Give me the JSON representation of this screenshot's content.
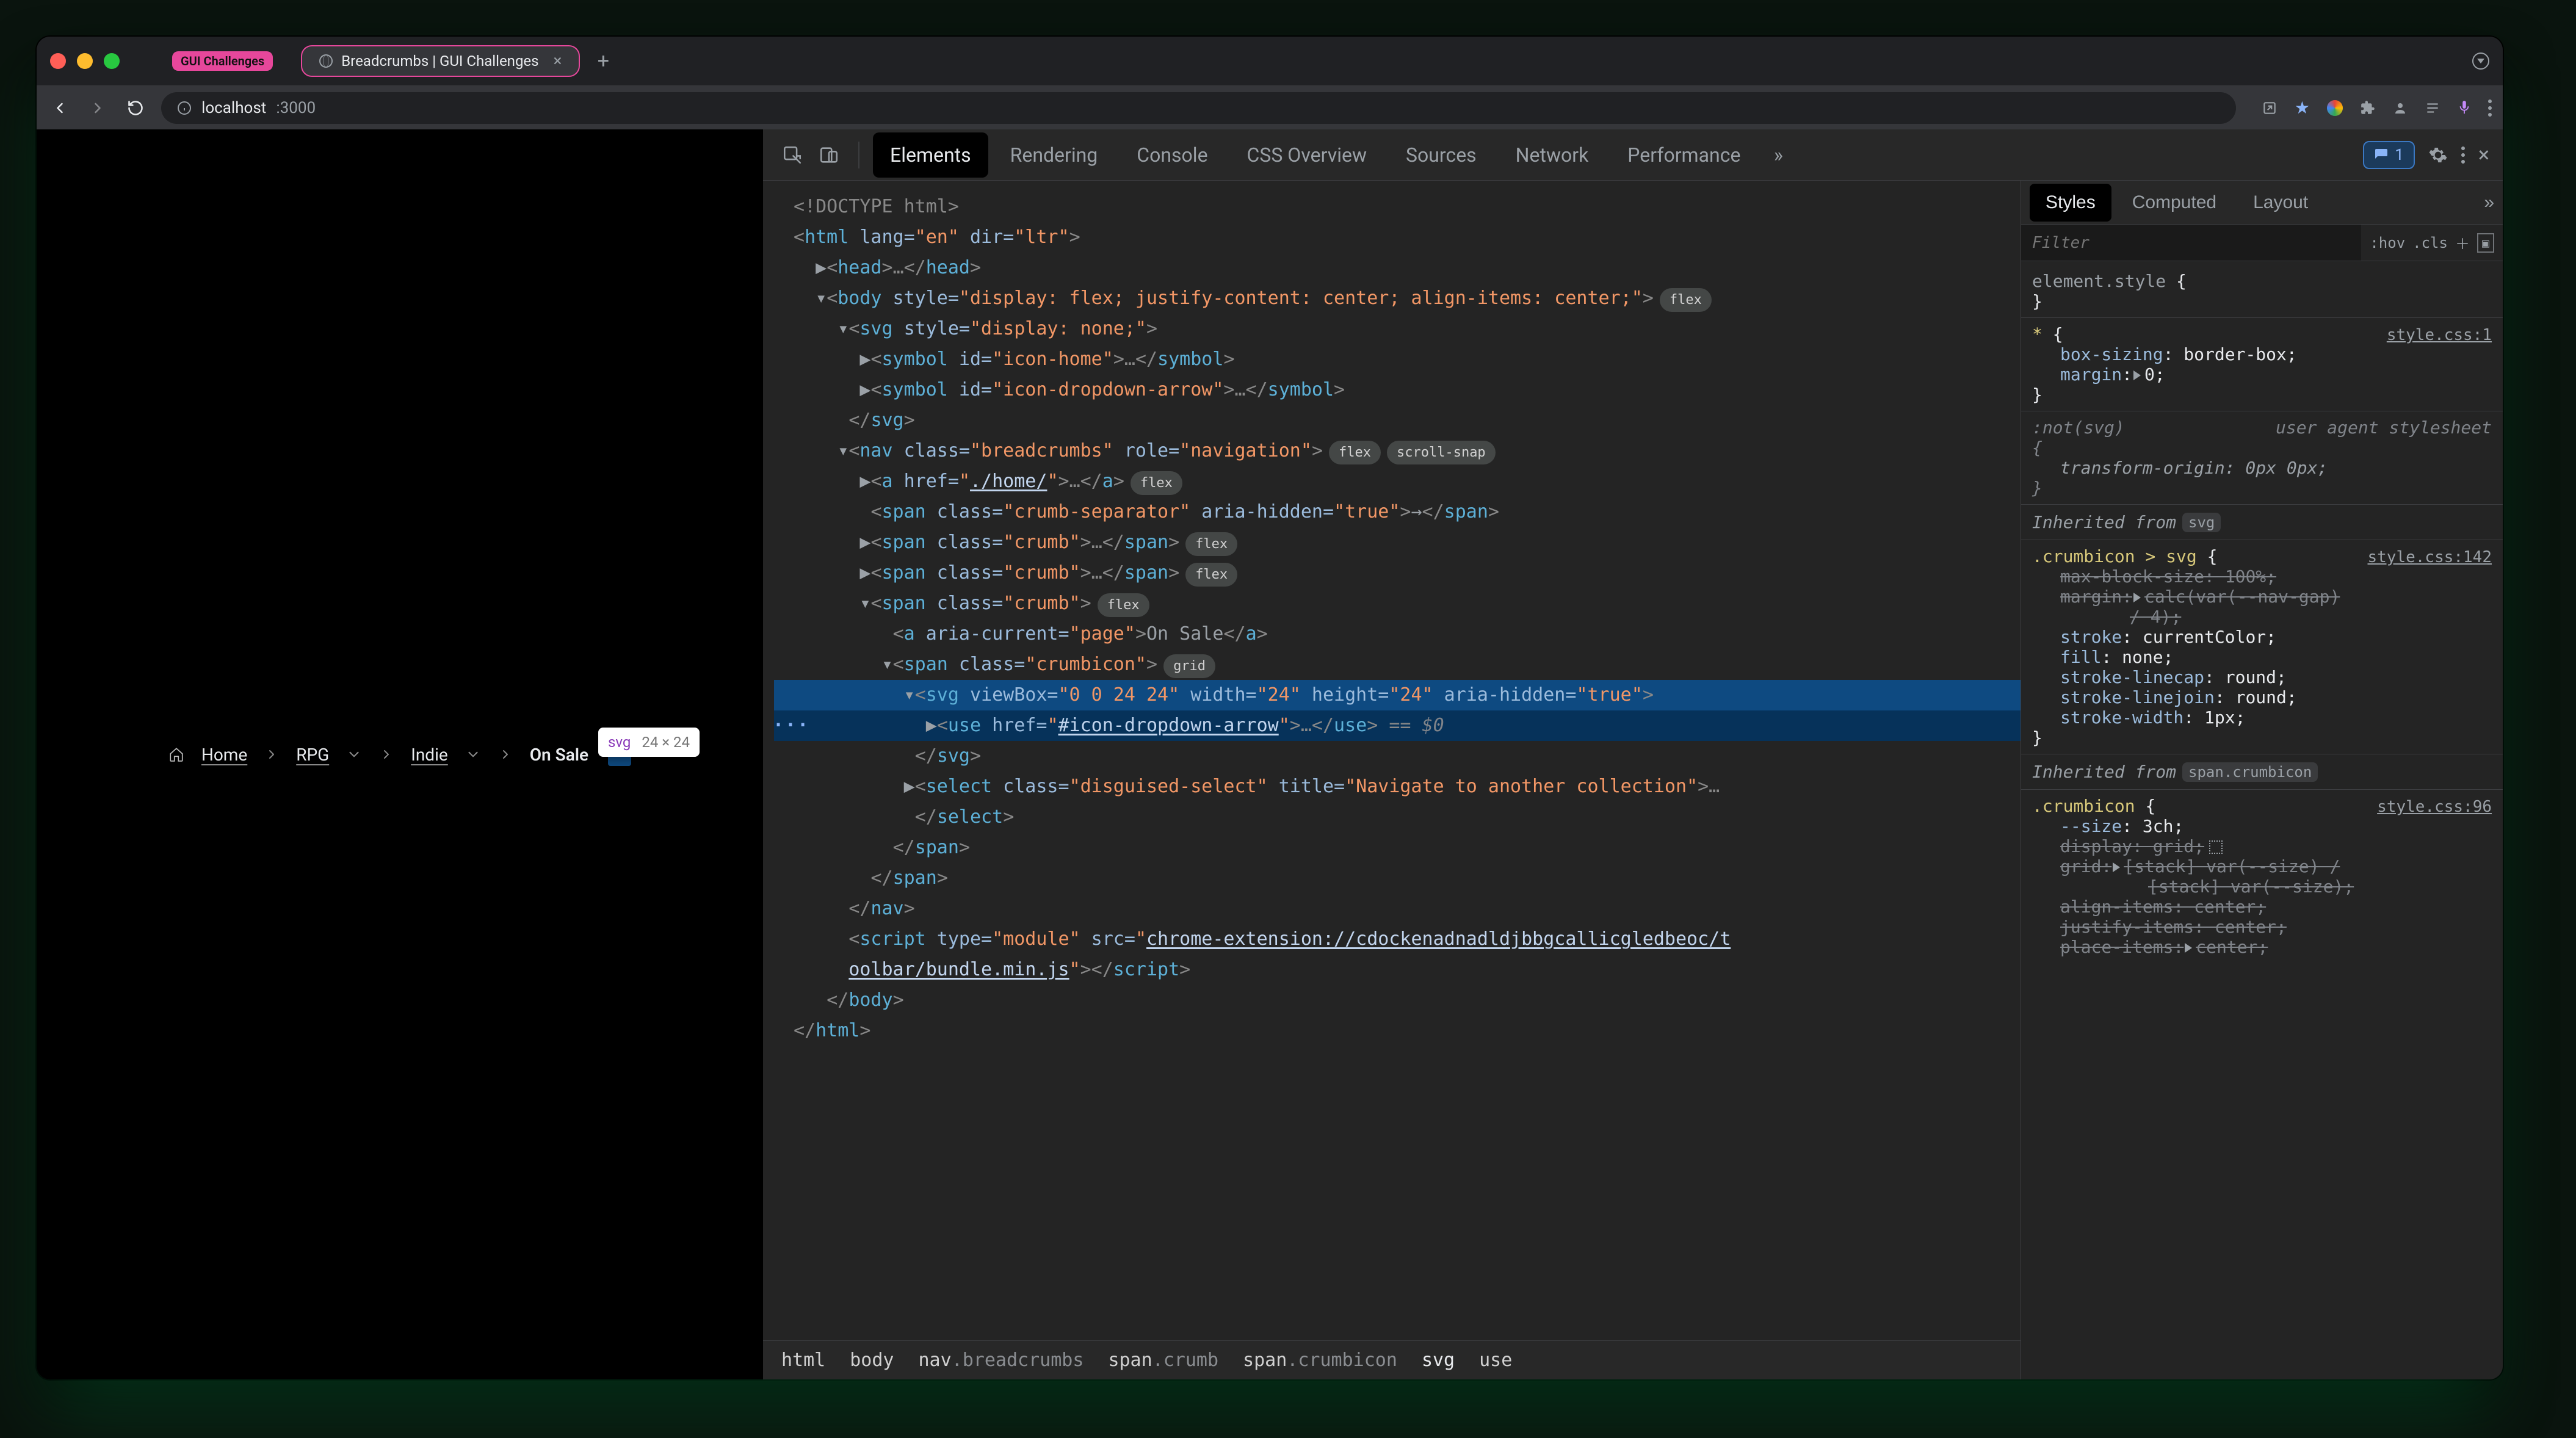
{
  "browser": {
    "tabs": {
      "inactive_chip": "GUI Challenges",
      "active_title": "Breadcrumbs | GUI Challenges"
    },
    "url_host": "localhost",
    "url_path": ":3000"
  },
  "page_breadcrumbs": {
    "home": "Home",
    "rpg": "RPG",
    "indie": "Indie",
    "onsale": "On Sale"
  },
  "tooltip": {
    "tag": "svg",
    "dims": "24 × 24"
  },
  "devtools": {
    "tabs": {
      "elements": "Elements",
      "rendering": "Rendering",
      "console": "Console",
      "cssoverview": "CSS Overview",
      "sources": "Sources",
      "network": "Network",
      "performance": "Performance"
    },
    "issues_count": "1",
    "styles_tabs": {
      "styles": "Styles",
      "computed": "Computed",
      "layout": "Layout"
    },
    "filter_placeholder": "Filter",
    "filter_hov": ":hov",
    "filter_cls": ".cls",
    "dom_crumbs_parts": {
      "html": "html",
      "body": "body",
      "nav": "nav",
      "navcls": ".breadcrumbs",
      "span1": "span",
      "span1cls": ".crumb",
      "span2": "span",
      "span2cls": ".crumbicon",
      "svg": "svg",
      "use": "use"
    }
  },
  "dom": {
    "l1": "<!DOCTYPE html>",
    "l2_open": "<",
    "l2_tag": "html",
    "l2_a1": " lang=",
    "l2_v1": "\"en\"",
    "l2_a2": " dir=",
    "l2_v2": "\"ltr\"",
    "l2_close": ">",
    "l3_tri": "▶",
    "l3_open": "<",
    "l3_tag": "head",
    "l3_close": ">",
    "l3_dots": "…",
    "l3_endopen": "</",
    "l3_endtag": "head",
    "l3_endclose": ">",
    "l4_tri": "▾",
    "l4_open": "<",
    "l4_tag": "body",
    "l4_a1": " style=",
    "l4_v1": "\"display: flex; justify-content: center; align-items: center;\"",
    "l4_close": ">",
    "l4_pill": "flex",
    "l5_tri": "▾",
    "l5_open": "<",
    "l5_tag": "svg",
    "l5_a1": " style=",
    "l5_v1": "\"display: none;\"",
    "l5_close": ">",
    "l6_tri": "▶",
    "l6_open": "<",
    "l6_tag": "symbol",
    "l6_a1": " id=",
    "l6_v1": "\"icon-home\"",
    "l6_close": ">",
    "l6_dots": "…",
    "l6_endopen": "</",
    "l6_endtag": "symbol",
    "l6_endclose": ">",
    "l7_tri": "▶",
    "l7_open": "<",
    "l7_tag": "symbol",
    "l7_a1": " id=",
    "l7_v1": "\"icon-dropdown-arrow\"",
    "l7_close": ">",
    "l7_dots": "…",
    "l7_endopen": "</",
    "l7_endtag": "symbol",
    "l7_endclose": ">",
    "l8_open": "</",
    "l8_tag": "svg",
    "l8_close": ">",
    "l9_tri": "▾",
    "l9_open": "<",
    "l9_tag": "nav",
    "l9_a1": " class=",
    "l9_v1": "\"breadcrumbs\"",
    "l9_a2": " role=",
    "l9_v2": "\"navigation\"",
    "l9_close": ">",
    "l9_pill1": "flex",
    "l9_pill2": "scroll-snap",
    "l10_tri": "▶",
    "l10_open": "<",
    "l10_tag": "a",
    "l10_a1": " href=",
    "l10_v1": "\"",
    "l10_link": "./home/",
    "l10_v1b": "\"",
    "l10_close": ">",
    "l10_dots": "…",
    "l10_endopen": "</",
    "l10_endtag": "a",
    "l10_endclose": ">",
    "l10_pill": "flex",
    "l11_open": "<",
    "l11_tag": "span",
    "l11_a1": " class=",
    "l11_v1": "\"crumb-separator\"",
    "l11_a2": " aria-hidden=",
    "l11_v2": "\"true\"",
    "l11_close": ">",
    "l11_text": "→",
    "l11_endopen": "</",
    "l11_endtag": "span",
    "l11_endclose": ">",
    "l12_tri": "▶",
    "l12_open": "<",
    "l12_tag": "span",
    "l12_a1": " class=",
    "l12_v1": "\"crumb\"",
    "l12_close": ">",
    "l12_dots": "…",
    "l12_endopen": "</",
    "l12_endtag": "span",
    "l12_endclose": ">",
    "l12_pill": "flex",
    "l13_tri": "▶",
    "l13_open": "<",
    "l13_tag": "span",
    "l13_a1": " class=",
    "l13_v1": "\"crumb\"",
    "l13_close": ">",
    "l13_dots": "…",
    "l13_endopen": "</",
    "l13_endtag": "span",
    "l13_endclose": ">",
    "l13_pill": "flex",
    "l14_tri": "▾",
    "l14_open": "<",
    "l14_tag": "span",
    "l14_a1": " class=",
    "l14_v1": "\"crumb\"",
    "l14_close": ">",
    "l14_pill": "flex",
    "l15_open": "<",
    "l15_tag": "a",
    "l15_a1": " aria-current=",
    "l15_v1": "\"page\"",
    "l15_close": ">",
    "l15_text": "On Sale",
    "l15_endopen": "</",
    "l15_endtag": "a",
    "l15_endclose": ">",
    "l16_tri": "▾",
    "l16_open": "<",
    "l16_tag": "span",
    "l16_a1": " class=",
    "l16_v1": "\"crumbicon\"",
    "l16_close": ">",
    "l16_pill": "grid",
    "l17_tri": "▾",
    "l17_open": "<",
    "l17_tag": "svg",
    "l17_a1": " viewBox=",
    "l17_v1": "\"0 0 24 24\"",
    "l17_a2": " width=",
    "l17_v2": "\"24\"",
    "l17_a3": " height=",
    "l17_v3": "\"24\"",
    "l17_a4": " aria-hidden=",
    "l17_v4": "\"true\"",
    "l17_close": ">",
    "l18_tri": "▶",
    "l18_open": "<",
    "l18_tag": "use",
    "l18_a1": " href=",
    "l18_v1": "\"",
    "l18_link": "#icon-dropdown-arrow",
    "l18_v1b": "\"",
    "l18_close": ">",
    "l18_dots": "…",
    "l18_endopen": "</",
    "l18_endtag": "use",
    "l18_endclose": ">",
    "l18_eq": " == ",
    "l18_dollar": "$0",
    "l19_open": "</",
    "l19_tag": "svg",
    "l19_close": ">",
    "l20_tri": "▶",
    "l20_open": "<",
    "l20_tag": "select",
    "l20_a1": " class=",
    "l20_v1": "\"disguised-select\"",
    "l20_a2": " title=",
    "l20_v2": "\"Navigate to another collection\"",
    "l20_close": ">",
    "l20_dots": "…",
    "l21_open": "</",
    "l21_tag": "select",
    "l21_close": ">",
    "l22_open": "</",
    "l22_tag": "span",
    "l22_close": ">",
    "l23_open": "</",
    "l23_tag": "span",
    "l23_close": ">",
    "l24_open": "</",
    "l24_tag": "nav",
    "l24_close": ">",
    "l25_open": "<",
    "l25_tag": "script",
    "l25_a1": " type=",
    "l25_v1": "\"module\"",
    "l25_a2": " src=",
    "l25_v2": "\"",
    "l25_link": "chrome-extension://cdockenadnadldjbbgcallicgledbeoc/t",
    "l25_link2": "oolbar/bundle.min.js",
    "l25_v2b": "\"",
    "l25_close": ">",
    "l25_endopen": "</",
    "l25_endtag": "script",
    "l25_endclose": ">",
    "l26_open": "</",
    "l26_tag": "body",
    "l26_close": ">",
    "l27_open": "</",
    "l27_tag": "html",
    "l27_close": ">"
  },
  "styles": {
    "r1_sel": "element.style ",
    "r1_open": "{",
    "r1_close": "}",
    "r2_sel": "* ",
    "r2_open": "{",
    "r2_src": "style.css:1",
    "r2_d1_p": "box-sizing",
    "r2_d1_v": ": border-box;",
    "r2_d2_p": "margin",
    "r2_d2_v": ":",
    "r2_d2_vb": "0;",
    "r2_close": "}",
    "r3_sel": ":not(svg) ",
    "r3_ua": "user agent stylesheet",
    "r3_open": "{",
    "r3_d1_p": "transform-origin",
    "r3_d1_v": ": 0px 0px;",
    "r3_close": "}",
    "inh1_label": "Inherited from ",
    "inh1_kw": "svg",
    "r4_sel": ".crumbicon > svg ",
    "r4_open": "{",
    "r4_src": "style.css:142",
    "r4_d1_p": "max-block-size",
    "r4_d1_v": ": 100%;",
    "r4_d2_p": "margin",
    "r4_d2_v": ":",
    "r4_d2_vb": "calc(var(--nav-gap)",
    "r4_d2_vc": "/ 4);",
    "r4_d3_p": "stroke",
    "r4_d3_v": ": currentColor;",
    "r4_d4_p": "fill",
    "r4_d4_v": ": none;",
    "r4_d5_p": "stroke-linecap",
    "r4_d5_v": ": round;",
    "r4_d6_p": "stroke-linejoin",
    "r4_d6_v": ": round;",
    "r4_d7_p": "stroke-width",
    "r4_d7_v": ": 1px;",
    "r4_close": "}",
    "inh2_label": "Inherited from ",
    "inh2_kw": "span.crumbicon",
    "r5_sel": ".crumbicon ",
    "r5_open": "{",
    "r5_src": "style.css:96",
    "r5_d1_p": "--size",
    "r5_d1_v": ": 3ch;",
    "r5_d2_p": "display",
    "r5_d2_v": ": grid;",
    "r5_d3_p": "grid",
    "r5_d3_v": ":",
    "r5_d3_vb": "[stack] var(--size) /",
    "r5_d3_vc": "[stack] var(--size);",
    "r5_d4_p": "align-items",
    "r5_d4_v": ": center;",
    "r5_d5_p": "justify-items",
    "r5_d5_v": ": center;",
    "r5_d6_p": "place-items",
    "r5_d6_v": ":",
    "r5_d6_vb": "center;"
  }
}
